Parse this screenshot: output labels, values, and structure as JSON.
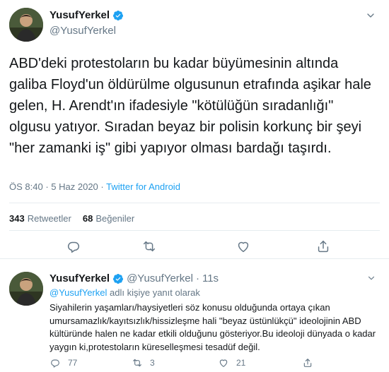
{
  "main_tweet": {
    "display_name": "YusufYerkel",
    "handle": "@YusufYerkel",
    "text": "ABD'deki protestoların bu kadar büyümesinin altında galiba Floyd'un öldürülme olgusunun etrafında aşikar hale gelen, H. Arendt'ın ifadesiyle \"kötülüğün sıradanlığı\" olgusu yatıyor. Sıradan beyaz bir polisin korkunç bir şeyi \"her zamanki iş\" gibi yapıyor olması bardağı taşırdı.",
    "time": "ÖS 8:40",
    "separator1": "·",
    "date": "5 Haz 2020",
    "separator2": "·",
    "source": "Twitter for Android",
    "retweets_count": "343",
    "retweets_label": "Retweetler",
    "likes_count": "68",
    "likes_label": "Beğeniler"
  },
  "reply_tweet": {
    "display_name": "YusufYerkel",
    "handle": "@YusufYerkel",
    "separator": "·",
    "time": "11s",
    "reply_mention": "@YusufYerkel",
    "reply_suffix": "adlı kişiye yanıt olarak",
    "text": "Siyahilerin yaşamları/haysiyetleri söz konusu olduğunda ortaya çıkan umursamazlık/kayıtsızlık/hissizleşme hali \"beyaz üstünlükçü\" ideolojinin ABD kültüründe halen ne kadar etkili olduğunu gösteriyor.Bu ideoloji dünyada o kadar yaygın ki,protestoların küreselleşmesi tesadüf değil.",
    "replies": "77",
    "retweets": "3",
    "likes": "21"
  },
  "colors": {
    "text": "#14171a",
    "secondary": "#657786",
    "accent": "#1da1f2",
    "border": "#e6ecf0"
  },
  "icons": [
    "verified-badge-icon",
    "chevron-down-icon",
    "reply-icon",
    "retweet-icon",
    "like-icon",
    "share-icon"
  ]
}
